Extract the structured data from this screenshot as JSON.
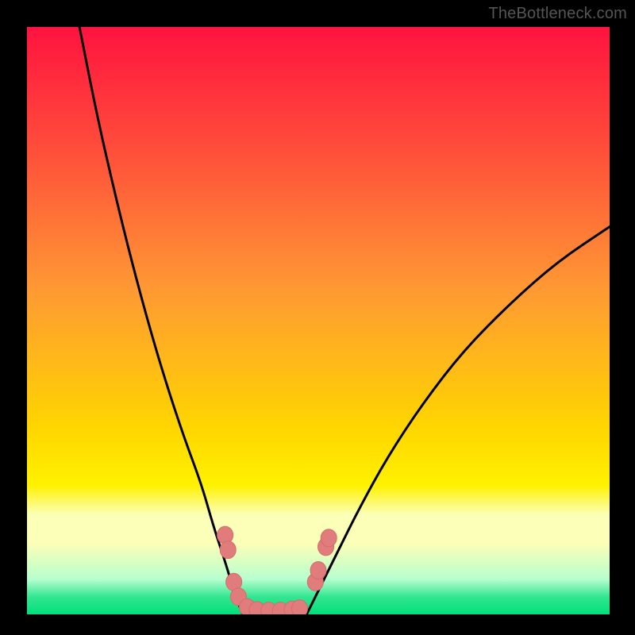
{
  "watermark": "TheBottleneck.com",
  "colors": {
    "top_gradient": "#ff133f",
    "mid_gradient": "#ffd500",
    "yellow_band": "#fbffb7",
    "green_band": "#00e07a",
    "curve": "#000000",
    "marker_fill": "#e17c7c",
    "marker_stroke": "#d86a6a"
  },
  "chart_data": {
    "type": "line",
    "title": "",
    "xlabel": "",
    "ylabel": "",
    "xlim": [
      0,
      100
    ],
    "ylim": [
      0,
      100
    ],
    "legend": false,
    "grid": false,
    "axes_visible": false,
    "series": [
      {
        "name": "left-branch",
        "x": [
          9,
          12,
          15,
          18,
          21,
          24,
          27,
          30,
          32,
          34,
          35.5,
          37
        ],
        "values": [
          100,
          85,
          72,
          60,
          49,
          39,
          30,
          22,
          15,
          9,
          4,
          0
        ]
      },
      {
        "name": "valley-floor",
        "x": [
          37,
          40,
          43,
          46,
          48
        ],
        "values": [
          0,
          0,
          0,
          0,
          0
        ]
      },
      {
        "name": "right-branch",
        "x": [
          48,
          50,
          53,
          57,
          62,
          68,
          75,
          83,
          91,
          100
        ],
        "values": [
          0,
          4,
          10,
          18,
          27,
          36,
          45,
          53,
          60,
          66
        ]
      }
    ],
    "markers": [
      {
        "x": 34.0,
        "y": 13.5
      },
      {
        "x": 34.5,
        "y": 11.0
      },
      {
        "x": 35.5,
        "y": 5.5
      },
      {
        "x": 36.3,
        "y": 3.0
      },
      {
        "x": 37.8,
        "y": 1.2
      },
      {
        "x": 39.5,
        "y": 0.7
      },
      {
        "x": 41.5,
        "y": 0.6
      },
      {
        "x": 43.5,
        "y": 0.6
      },
      {
        "x": 45.5,
        "y": 0.8
      },
      {
        "x": 46.8,
        "y": 1.0
      },
      {
        "x": 49.5,
        "y": 5.5
      },
      {
        "x": 50.0,
        "y": 7.5
      },
      {
        "x": 51.3,
        "y": 11.5
      },
      {
        "x": 51.8,
        "y": 13.0
      }
    ],
    "annotations": []
  }
}
